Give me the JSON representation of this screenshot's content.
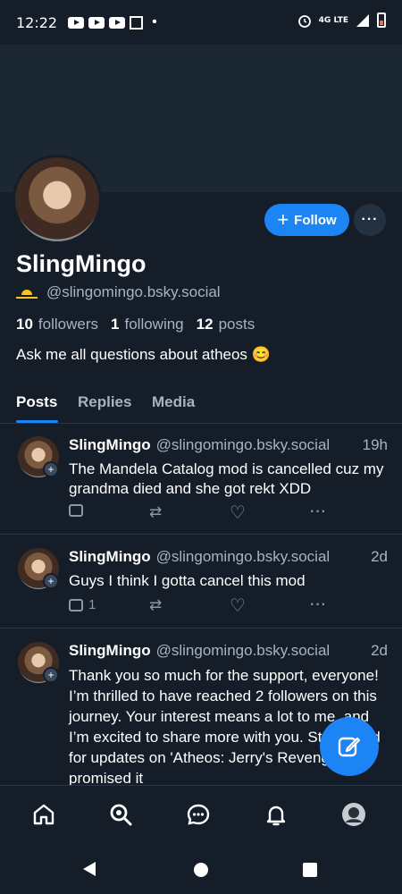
{
  "status_bar": {
    "time": "12:22",
    "dot": "•",
    "network": "4G LTE"
  },
  "profile": {
    "display_name": "SlingMingo",
    "handle": "@slingomingo.bsky.social",
    "followers_count": "10",
    "followers_label": "followers",
    "following_count": "1",
    "following_label": "following",
    "posts_count": "12",
    "posts_label": "posts",
    "bio": "Ask me all questions about atheos 😊",
    "follow_label": "Follow",
    "follow_plus": "+",
    "more_label": "···"
  },
  "tabs": [
    {
      "label": "Posts",
      "active": true
    },
    {
      "label": "Replies",
      "active": false
    },
    {
      "label": "Media",
      "active": false
    }
  ],
  "posts": [
    {
      "author": "SlingMingo",
      "handle": "@slingomingo.bsky.social",
      "time": "19h",
      "text": "The Mandela Catalog mod is cancelled cuz my grandma died and she got rekt XDD",
      "reply_count": "",
      "more": "···"
    },
    {
      "author": "SlingMingo",
      "handle": "@slingomingo.bsky.social",
      "time": "2d",
      "text": "Guys I think I gotta cancel this mod",
      "reply_count": "1",
      "more": "···"
    },
    {
      "author": "SlingMingo",
      "handle": "@slingomingo.bsky.social",
      "time": "2d",
      "text": "Thank you so much for the support, everyone! I’m thrilled to have reached 2 followers on this journey. Your interest means a lot to me, and I’m excited to share more with you. Stay tuned for updates on 'Atheos: Jerry's Revenge!'. I promised it",
      "reply_count": "",
      "more": "···"
    }
  ],
  "avatar_plus": "+",
  "colors": {
    "accent": "#1d84f6",
    "background": "#151d28",
    "muted": "#a8b3c1"
  },
  "icons": [
    "home-icon",
    "search-icon",
    "chat-icon",
    "bell-icon",
    "profile-avatar-icon",
    "compose-icon"
  ]
}
